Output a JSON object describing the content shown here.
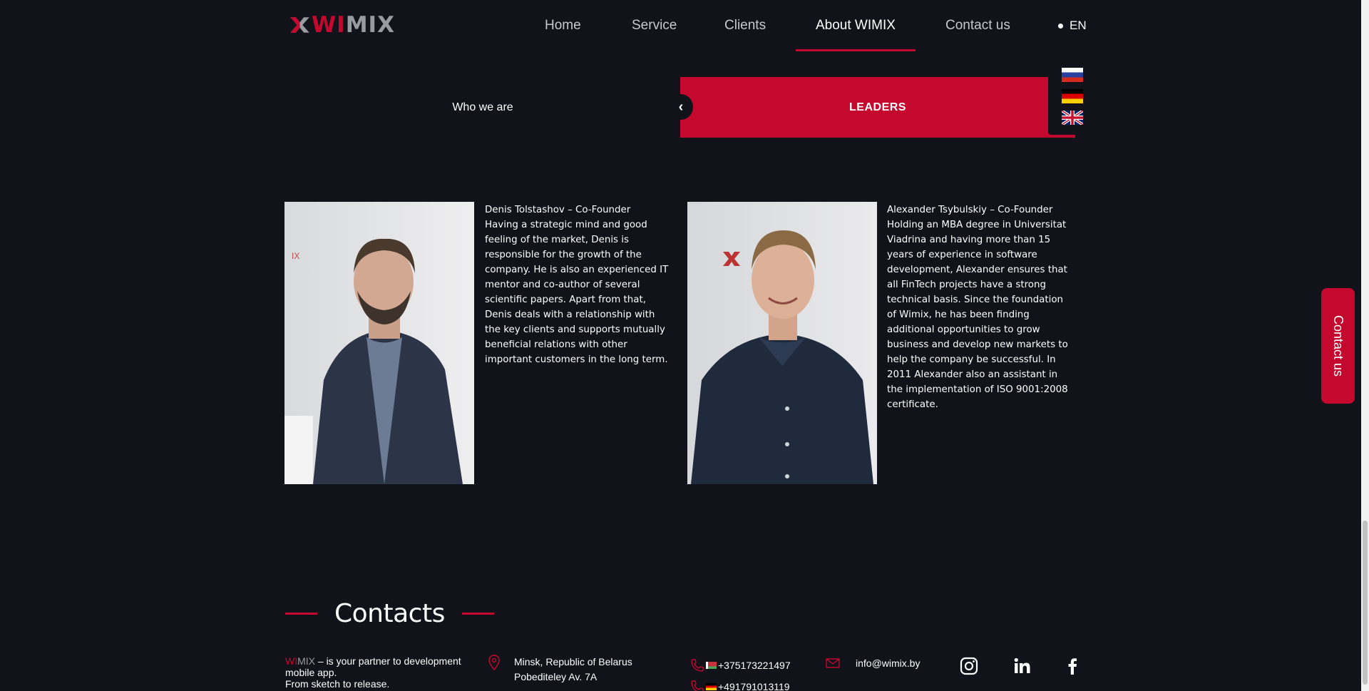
{
  "brand": {
    "logo_wi": "WI",
    "logo_mix": "MIX"
  },
  "nav": {
    "items": [
      {
        "label": "Home"
      },
      {
        "label": "Service"
      },
      {
        "label": "Clients"
      },
      {
        "label": "About WIMIX"
      },
      {
        "label": "Contact us"
      }
    ],
    "active": "About WIMIX",
    "language": "EN"
  },
  "language_menu": {
    "options": [
      "ru-flag",
      "de-flag",
      "gb-flag"
    ]
  },
  "tabs": {
    "left": "Who we are",
    "right": "LEADERS"
  },
  "leaders": [
    {
      "name": "Denis Tolstashov – Co-Founder",
      "bio": "Having a strategic mind and good feeling of the market, Denis is responsible for the growth of the company. He is also an experienced IT mentor and co-author of several scientific papers. Apart from that, Denis deals with a relationship with the key clients and supports mutually beneficial relations with other important customers in the long term."
    },
    {
      "name": "Alexander Tsybulskiy – Co-Founder",
      "bio": "Holding an MBA degree in Universitat Viadrina and having more than 15 years of experience in software development, Alexander ensures that all FinTech projects have a strong technical basis. Since the foundation of Wimix, he has been finding additional opportunities to grow business and develop new markets to help the company be successful. In 2011 Alexander also an assistant in the implementation of ISO 9001:2008 certificate."
    }
  ],
  "side_tab": {
    "label": "Contact us"
  },
  "contacts": {
    "heading": "Contacts",
    "about_wi": "WI",
    "about_mix": "MIX",
    "about_line1": " – is your partner to development mobile app.",
    "about_line2": "From sketch to release.",
    "address_line1": "Minsk, Republic of Belarus",
    "address_line2": "Pobediteley Av. 7A",
    "phone_by": "+375173221497",
    "phone_de": "+491791013119",
    "email": "info@wimix.by"
  },
  "colors": {
    "accent": "#c4082e",
    "background": "#11121a"
  }
}
